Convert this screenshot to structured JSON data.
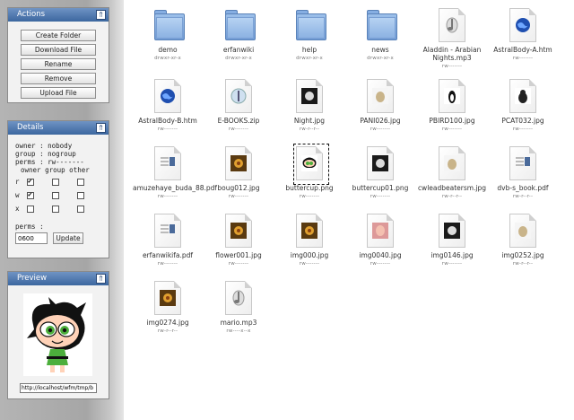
{
  "sidebar": {
    "actions": {
      "title": "Actions",
      "buttons": [
        "Create Folder",
        "Download File",
        "Rename",
        "Remove",
        "Upload File"
      ]
    },
    "details": {
      "title": "Details",
      "owner_line": "owner : nobody",
      "group_line": "group : nogroup",
      "perms_line": "perms : rw-------",
      "matrix_header": "owner group other",
      "row_labels": [
        "r",
        "w",
        "x"
      ],
      "matrix": [
        [
          true,
          false,
          false
        ],
        [
          true,
          false,
          false
        ],
        [
          false,
          false,
          false
        ]
      ],
      "perms_label": "perms :",
      "perms_value": "0600",
      "update_label": "Update"
    },
    "preview": {
      "title": "Preview",
      "url_value": "http://localhost/wfm/tmp/b"
    }
  },
  "files": [
    {
      "name": "demo",
      "perm": "drwxr-xr-x",
      "type": "folder"
    },
    {
      "name": "erfanwiki",
      "perm": "drwxr-xr-x",
      "type": "folder"
    },
    {
      "name": "help",
      "perm": "drwxr-xr-x",
      "type": "folder"
    },
    {
      "name": "news",
      "perm": "drwxr-xr-x",
      "type": "folder"
    },
    {
      "name": "Aladdin - Arabian Nights.mp3",
      "perm": "rw-------",
      "type": "audio"
    },
    {
      "name": "AstralBody-A.htm",
      "perm": "rw-------",
      "type": "html"
    },
    {
      "name": "AstralBody-B.htm",
      "perm": "rw-------",
      "type": "html"
    },
    {
      "name": "E-BOOKS.zip",
      "perm": "rw-------",
      "type": "zip"
    },
    {
      "name": "Night.jpg",
      "perm": "rw-r--r--",
      "type": "image-dark"
    },
    {
      "name": "PANI026.jpg",
      "perm": "rw-------",
      "type": "image-light"
    },
    {
      "name": "PBIRD100.jpg",
      "perm": "rw-------",
      "type": "image-bird"
    },
    {
      "name": "PCAT032.jpg",
      "perm": "rw-------",
      "type": "image-cat"
    },
    {
      "name": "amuzehaye_buda_88.pdf",
      "perm": "rw-------",
      "type": "pdf"
    },
    {
      "name": "boug012.jpg",
      "perm": "rw-------",
      "type": "image-photo"
    },
    {
      "name": "buttercup.png",
      "perm": "rw-------",
      "type": "image-buttercup"
    },
    {
      "name": "buttercup01.png",
      "perm": "rw-------",
      "type": "image-dark"
    },
    {
      "name": "cwleadbeatersm.jpg",
      "perm": "rw-r--r--",
      "type": "image-light"
    },
    {
      "name": "dvb-s_book.pdf",
      "perm": "rw-r--r--",
      "type": "pdf"
    },
    {
      "name": "erfanwikifa.pdf",
      "perm": "rw-------",
      "type": "pdf"
    },
    {
      "name": "flower001.jpg",
      "perm": "rw-------",
      "type": "image-photo"
    },
    {
      "name": "img000.jpg",
      "perm": "rw-------",
      "type": "image-photo"
    },
    {
      "name": "img0040.jpg",
      "perm": "rw-------",
      "type": "image-pink"
    },
    {
      "name": "img0146.jpg",
      "perm": "rw-------",
      "type": "image-dark"
    },
    {
      "name": "img0252.jpg",
      "perm": "rw-r--r--",
      "type": "image-light"
    },
    {
      "name": "img0274.jpg",
      "perm": "rw-r--r--",
      "type": "image-photo"
    },
    {
      "name": "mario.mp3",
      "perm": "rw----x--x",
      "type": "audio"
    }
  ],
  "selected_file": "buttercup.png",
  "colors": {
    "header_blue": "#3c679f",
    "folder_blue": "#6f9bd6",
    "sidebar_gray": "#a6a6a6"
  }
}
